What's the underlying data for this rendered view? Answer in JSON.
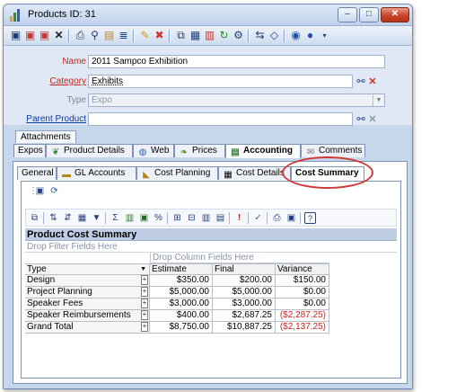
{
  "window": {
    "title": "Products ID: 31",
    "controls": {
      "minimize": "–",
      "maximize": "□",
      "close": "✕"
    }
  },
  "form": {
    "name_label": "Name",
    "name_value": "2011 Sampco Exhibition",
    "category_label": "Category",
    "category_value": "Exhibits",
    "type_label": "Type",
    "type_value": "Expo",
    "parent_label": "Parent Product",
    "parent_value": ""
  },
  "attachments_tab": "Attachments",
  "main_tabs": [
    {
      "label": "Expos",
      "icon": "",
      "active": false
    },
    {
      "label": "Product Details",
      "icon": "leaf-icon",
      "active": false
    },
    {
      "label": "Web",
      "icon": "globe-icon",
      "active": false
    },
    {
      "label": "Prices",
      "icon": "plant-icon",
      "active": false
    },
    {
      "label": "Accounting",
      "icon": "ledger-icon",
      "active": true
    },
    {
      "label": "Comments",
      "icon": "note-icon",
      "active": false
    }
  ],
  "sub_tabs": [
    {
      "label": "General",
      "icon": "",
      "active": false
    },
    {
      "label": "GL Accounts",
      "icon": "folder-icon",
      "active": false
    },
    {
      "label": "Cost Planning",
      "icon": "chart-icon",
      "active": false
    },
    {
      "label": "Cost Details",
      "icon": "grid-icon",
      "active": false
    },
    {
      "label": "Cost Summary",
      "icon": "",
      "active": true
    }
  ],
  "pivot": {
    "title": "Product Cost Summary",
    "filter_drop": "Drop Filter Fields Here",
    "column_drop": "Drop Column Fields Here",
    "row_header": "Type",
    "columns": [
      "Estimate",
      "Final",
      "Variance"
    ],
    "rows": [
      {
        "type": "Design",
        "estimate": "$350.00",
        "final": "$200.00",
        "variance": "$150.00",
        "negative": false
      },
      {
        "type": "Project Planning",
        "estimate": "$5,000.00",
        "final": "$5,000.00",
        "variance": "$0.00",
        "negative": false
      },
      {
        "type": "Speaker Fees",
        "estimate": "$3,000.00",
        "final": "$3,000.00",
        "variance": "$0.00",
        "negative": false
      },
      {
        "type": "Speaker Reimbursements",
        "estimate": "$400.00",
        "final": "$2,687.25",
        "variance": "($2,287.25)",
        "negative": true
      },
      {
        "type": "Grand Total",
        "estimate": "$8,750.00",
        "final": "$10,887.25",
        "variance": "($2,137.25)",
        "negative": true
      }
    ],
    "expand_glyph": "+"
  },
  "colors": {
    "accent_red": "#d03a36",
    "link_blue": "#0a3ca8",
    "required_red": "#c4281c"
  }
}
